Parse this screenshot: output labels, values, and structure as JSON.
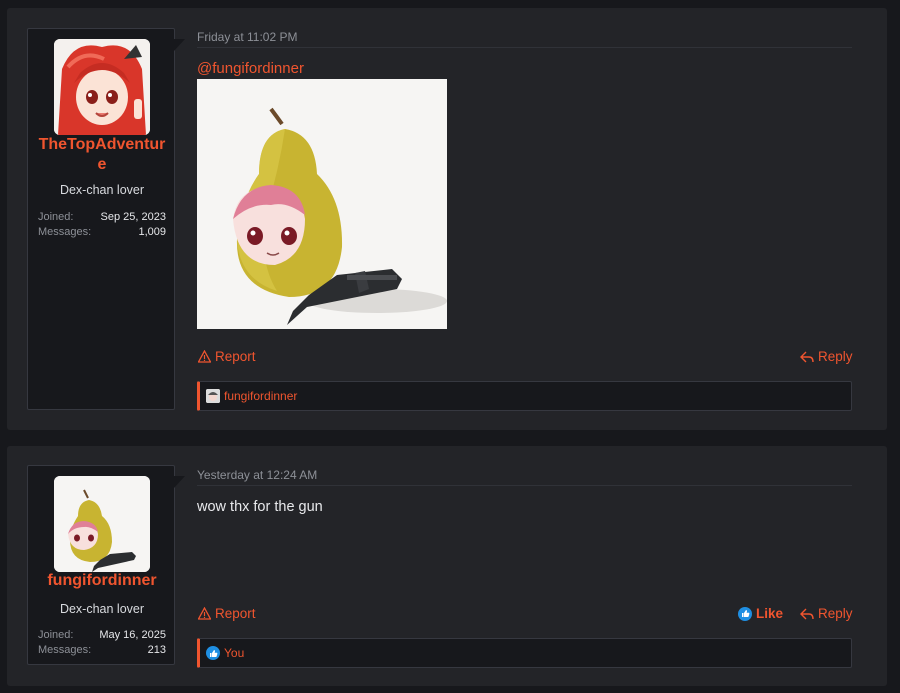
{
  "posts": [
    {
      "user": {
        "name": "TheTopAdventure",
        "title": "Dex-chan lover",
        "joined_label": "Joined:",
        "joined": "Sep 25, 2023",
        "messages_label": "Messages:",
        "messages": "1,009"
      },
      "date": "Friday at 11:02 PM",
      "mention": "@fungifordinner",
      "report_label": "Report",
      "reply_label": "Reply",
      "liked_by": "fungifordinner"
    },
    {
      "user": {
        "name": "fungifordinner",
        "title": "Dex-chan lover",
        "joined_label": "Joined:",
        "joined": "May 16, 2025",
        "messages_label": "Messages:",
        "messages": "213"
      },
      "date": "Yesterday at 12:24 AM",
      "text": "wow thx for the gun",
      "report_label": "Report",
      "like_label": "Like",
      "reply_label": "Reply",
      "liked_by": "You"
    }
  ],
  "colors": {
    "accent": "#f0552f",
    "bg": "#17181c",
    "panel": "#232428",
    "like_blue": "#1f8fe3"
  },
  "icons": [
    "warning-icon",
    "reply-icon",
    "thumbs-up-icon",
    "avatar-anime-girl",
    "avatar-pear"
  ]
}
